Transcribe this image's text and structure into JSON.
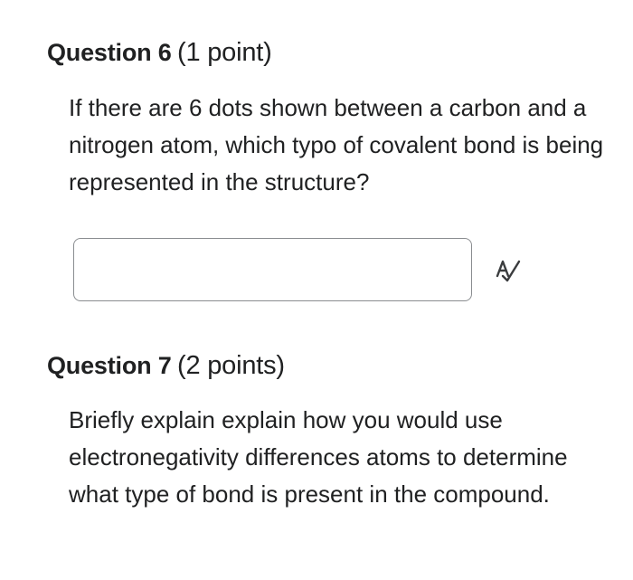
{
  "questions": [
    {
      "title": "Question 6",
      "points": "(1 point)",
      "text": "If there are 6 dots shown between a carbon and a nitrogen atom, which typo of covalent bond is being represented in the structure?",
      "answer": {
        "value": "",
        "placeholder": ""
      },
      "answer_icon": "spellcheck-icon"
    },
    {
      "title": "Question 7",
      "points": "(2 points)",
      "text": "Briefly explain explain how you would use electronegativity differences atoms to determine what type of bond is present in the compound."
    }
  ]
}
